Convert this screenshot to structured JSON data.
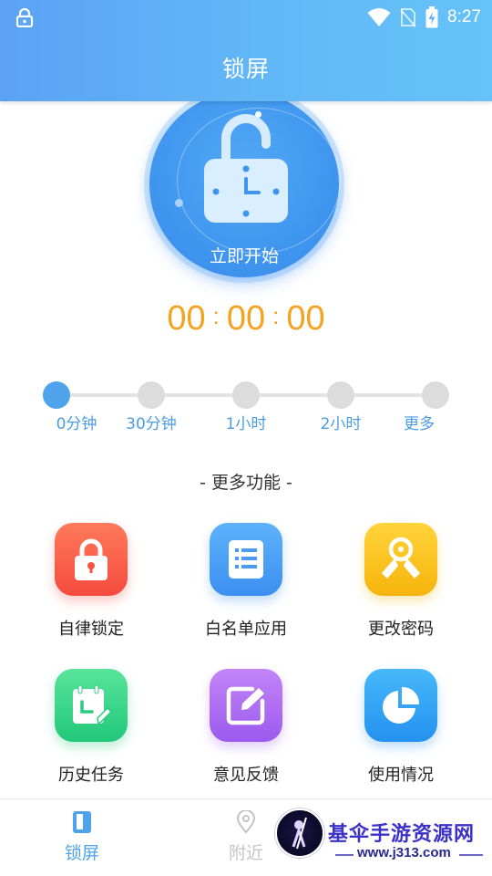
{
  "status_bar": {
    "time": "8:27",
    "icons": [
      "lock-icon",
      "wifi-icon",
      "no-sim-icon",
      "battery-charging-icon"
    ]
  },
  "header": {
    "title": "锁屏"
  },
  "start": {
    "label": "立即开始",
    "icon": "unlocked-clock-lock-icon"
  },
  "timer": {
    "hours": "00",
    "minutes": "00",
    "seconds": "00",
    "separator": ":"
  },
  "duration_options": [
    {
      "label": "0分钟",
      "selected": true
    },
    {
      "label": "30分钟",
      "selected": false
    },
    {
      "label": "1小时",
      "selected": false
    },
    {
      "label": "2小时",
      "selected": false
    },
    {
      "label": "更多",
      "selected": false
    }
  ],
  "more_section": {
    "title": "- 更多功能 -"
  },
  "features": [
    {
      "label": "自律锁定",
      "icon": "padlock-icon",
      "color": "#f44a3f"
    },
    {
      "label": "白名单应用",
      "icon": "list-icon",
      "color": "#3c8ff0"
    },
    {
      "label": "更改密码",
      "icon": "keys-icon",
      "color": "#f6b40c"
    },
    {
      "label": "历史任务",
      "icon": "calendar-edit-icon",
      "color": "#22c87a"
    },
    {
      "label": "意见反馈",
      "icon": "edit-icon",
      "color": "#9b5aee"
    },
    {
      "label": "使用情况",
      "icon": "pie-chart-icon",
      "color": "#2491ef"
    }
  ],
  "bottom_nav": [
    {
      "label": "锁屏",
      "icon": "phone-lock-icon",
      "active": true
    },
    {
      "label": "附近",
      "icon": "location-pin-icon",
      "active": false
    }
  ],
  "watermark": {
    "title": "基伞手游资源网",
    "url": "www.j313.com"
  },
  "colors": {
    "accent": "#4ea3ea",
    "timer": "#f4a321",
    "header": "#5ba2f4"
  }
}
